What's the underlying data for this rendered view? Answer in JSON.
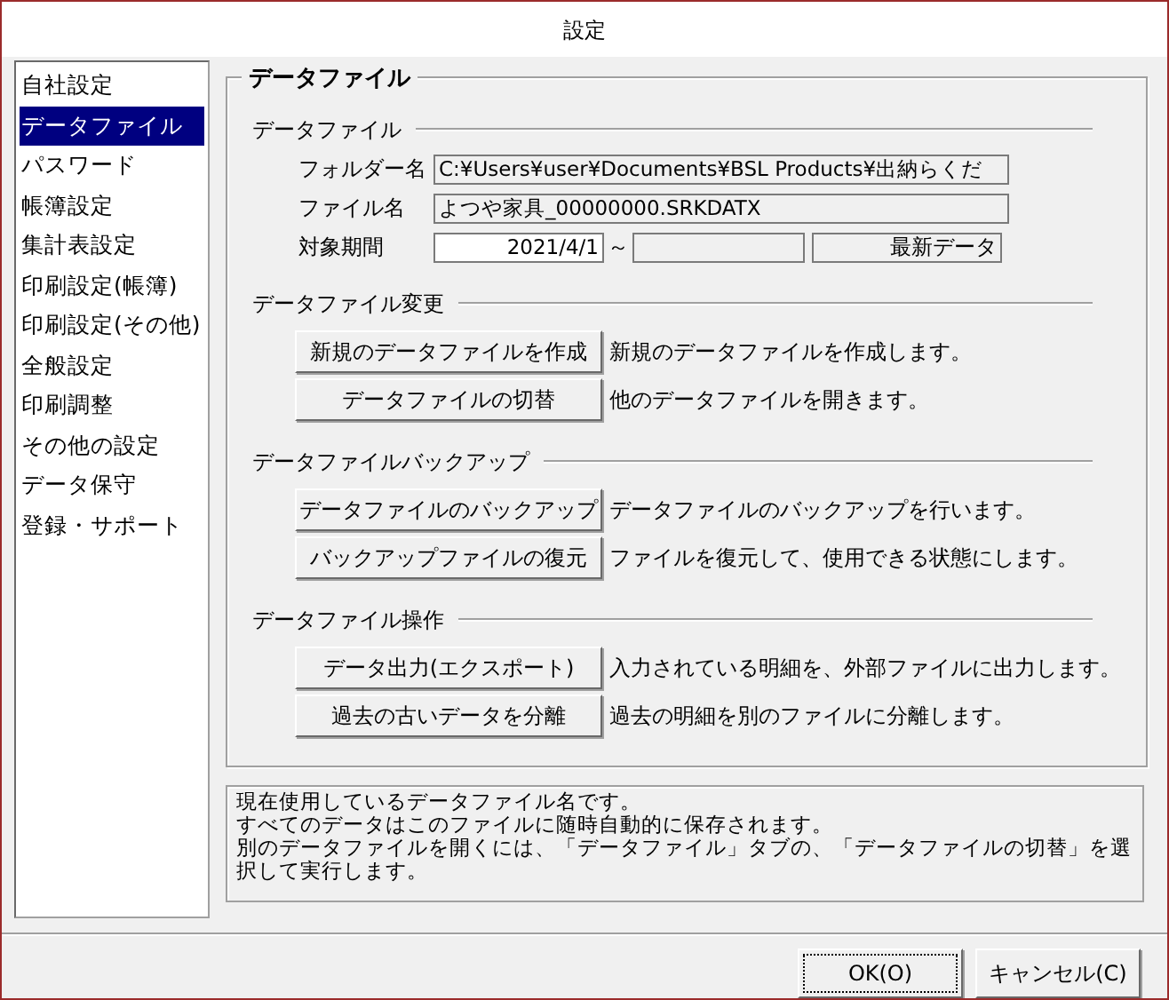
{
  "window": {
    "title": "設定"
  },
  "sidebar": {
    "items": [
      {
        "label": "自社設定",
        "selected": false
      },
      {
        "label": "データファイル",
        "selected": true
      },
      {
        "label": "パスワード",
        "selected": false
      },
      {
        "label": "帳簿設定",
        "selected": false
      },
      {
        "label": "集計表設定",
        "selected": false
      },
      {
        "label": "印刷設定(帳簿)",
        "selected": false
      },
      {
        "label": "印刷設定(その他)",
        "selected": false
      },
      {
        "label": "全般設定",
        "selected": false
      },
      {
        "label": "印刷調整",
        "selected": false
      },
      {
        "label": "その他の設定",
        "selected": false
      },
      {
        "label": "データ保守",
        "selected": false
      },
      {
        "label": "登録・サポート",
        "selected": false
      }
    ]
  },
  "panel": {
    "title": "データファイル",
    "sections": [
      {
        "title": "データファイル",
        "kind": "fields",
        "fields": [
          {
            "label": "フォルダー名",
            "value": "C:¥Users¥user¥Documents¥BSL Products¥出納らくだ"
          },
          {
            "label": "ファイル名",
            "value": "よつや家具_00000000.SRKDATX"
          }
        ],
        "period": {
          "label": "対象期間",
          "from": "2021/4/1",
          "separator": "～",
          "note": "最新データ"
        }
      },
      {
        "title": "データファイル変更",
        "kind": "actions",
        "actions": [
          {
            "button": "新規のデータファイルを作成",
            "description": "新規のデータファイルを作成します。"
          },
          {
            "button": "データファイルの切替",
            "description": "他のデータファイルを開きます。"
          }
        ]
      },
      {
        "title": "データファイルバックアップ",
        "kind": "actions",
        "actions": [
          {
            "button": "データファイルのバックアップ",
            "description": "データファイルのバックアップを行います。"
          },
          {
            "button": "バックアップファイルの復元",
            "description": "ファイルを復元して、使用できる状態にします。"
          }
        ]
      },
      {
        "title": "データファイル操作",
        "kind": "actions",
        "actions": [
          {
            "button": "データ出力(エクスポート)",
            "description": "入力されている明細を、外部ファイルに出力します。"
          },
          {
            "button": "過去の古いデータを分離",
            "description": "過去の明細を別のファイルに分離します。"
          }
        ]
      }
    ]
  },
  "help": {
    "lines": [
      "現在使用しているデータファイル名です。",
      "すべてのデータはこのファイルに随時自動的に保存されます。",
      "別のデータファイルを開くには、「データファイル」タブの、「データファイルの切替」を選択して実行します。"
    ]
  },
  "buttons": [
    {
      "label": "OK(O)",
      "focused": true
    },
    {
      "label": "キャンセル(C)",
      "focused": false
    }
  ]
}
